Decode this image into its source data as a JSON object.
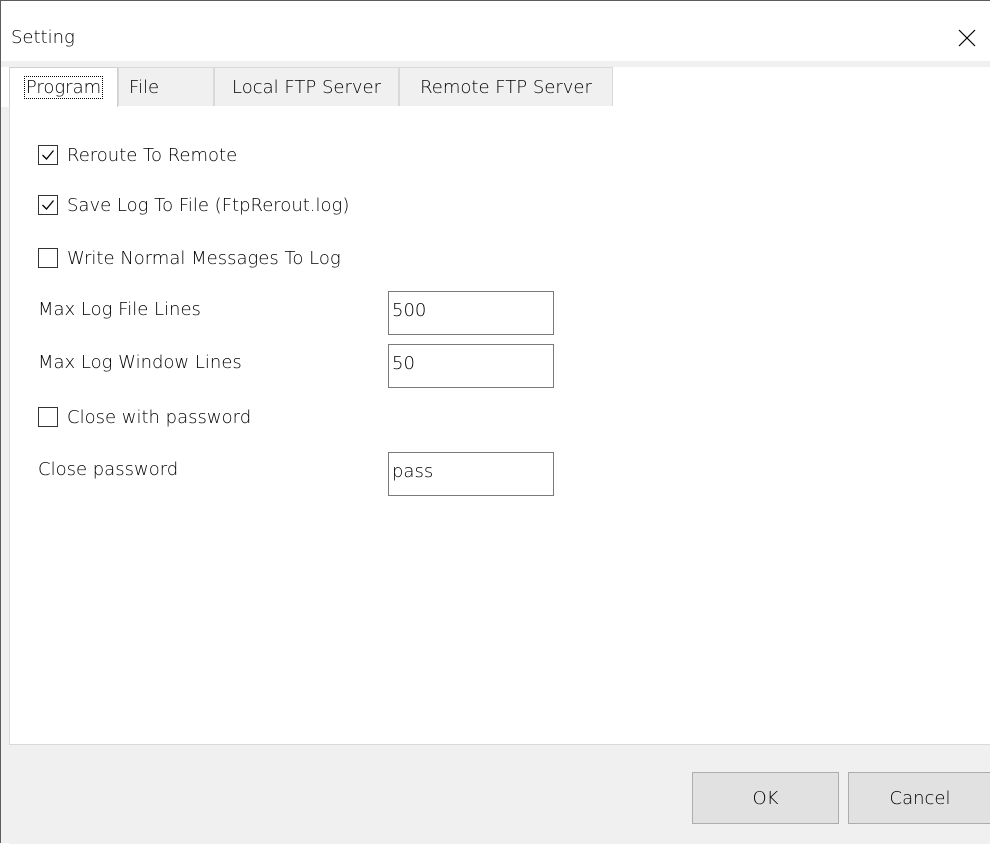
{
  "window": {
    "title": "Setting"
  },
  "tabs": [
    {
      "label": "Program",
      "active": true
    },
    {
      "label": "File",
      "active": false
    },
    {
      "label": "Local FTP Server",
      "active": false
    },
    {
      "label": "Remote FTP Server",
      "active": false
    }
  ],
  "program": {
    "reroute_to_remote": {
      "label": "Reroute To Remote",
      "checked": true
    },
    "save_log_to_file": {
      "label": "Save Log To File (FtpRerout.log)",
      "checked": true
    },
    "write_normal_messages": {
      "label": "Write Normal Messages To Log",
      "checked": false
    },
    "max_log_file_lines": {
      "label": "Max Log File Lines",
      "value": "500"
    },
    "max_log_window_lines": {
      "label": "Max Log Window Lines",
      "value": "50"
    },
    "close_with_password": {
      "label": "Close with password",
      "checked": false
    },
    "close_password": {
      "label": "Close password",
      "value": "pass"
    }
  },
  "buttons": {
    "ok": "OK",
    "cancel": "Cancel"
  },
  "icons": {
    "close": "close-icon",
    "check": "checkmark-icon"
  }
}
